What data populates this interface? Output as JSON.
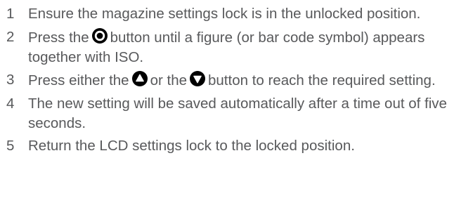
{
  "steps": [
    {
      "number": "1",
      "text": "Ensure the magazine settings lock is in the unlocked position."
    },
    {
      "number": "2",
      "text_before": "Press the",
      "icon": "select-button-icon",
      "text_after": "button until a figure (or bar code symbol) appears together with ISO."
    },
    {
      "number": "3",
      "text_before": "Press either the",
      "icon_1": "up-button-icon",
      "text_middle": "or the",
      "icon_2": "down-button-icon",
      "text_after": "button to reach the required setting."
    },
    {
      "number": "4",
      "text": "The new setting will be saved automatically after a time out of five seconds."
    },
    {
      "number": "5",
      "text": "Return the LCD settings lock to the locked position."
    }
  ]
}
